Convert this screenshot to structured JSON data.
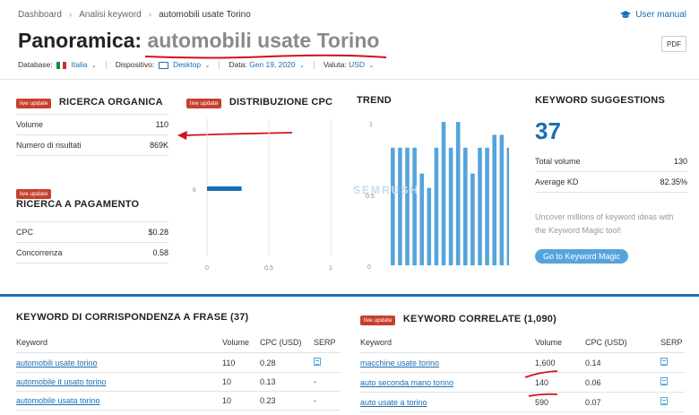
{
  "breadcrumb": {
    "items": [
      "Dashboard",
      "Analisi keyword",
      "automobili usate Torino"
    ]
  },
  "header": {
    "manual_label": "User manual",
    "title_prefix": "Panoramica:",
    "title_keyword": "automobili usate Torino",
    "pdf_label": "PDF"
  },
  "filters": {
    "database_label": "Database:",
    "database_value": "Italia",
    "device_label": "Dispositivo:",
    "device_value": "Desktop",
    "date_label": "Data:",
    "date_value": "Gen 19, 2020",
    "currency_label": "Valuta:",
    "currency_value": "USD"
  },
  "badge": "live update",
  "organic": {
    "title": "RICERCA ORGANICA",
    "rows": [
      {
        "label": "Volume",
        "value": "110"
      },
      {
        "label": "Numero di risultati",
        "value": "869K"
      }
    ]
  },
  "paid": {
    "title": "RICERCA A PAGAMENTO",
    "rows": [
      {
        "label": "CPC",
        "value": "$0.28"
      },
      {
        "label": "Concorrenza",
        "value": "0.58"
      }
    ]
  },
  "cpc_distribution": {
    "title": "DISTRIBUZIONE CPC",
    "bar_label": "it",
    "bar_value": 0.28,
    "ticks": [
      "0",
      "0.5",
      "1"
    ]
  },
  "trend": {
    "title": "TREND",
    "ytick_top": "1",
    "ytick_mid": "0.5",
    "ytick_bottom": "0",
    "watermark": "SEMRUSH",
    "values": [
      0.82,
      0.82,
      0.82,
      0.82,
      0.64,
      0.54,
      0.82,
      1.0,
      0.82,
      1.0,
      0.82,
      0.64,
      0.82,
      0.82,
      0.91,
      0.91,
      0.82
    ]
  },
  "suggestions": {
    "title": "KEYWORD SUGGESTIONS",
    "count": "37",
    "rows": [
      {
        "label": "Total volume",
        "value": "130"
      },
      {
        "label": "Average KD",
        "value": "82.35%"
      }
    ],
    "promo_line1": "Uncover millions of keyword ideas with",
    "promo_line2": "the Keyword Magic tool!",
    "button": "Go to Keyword Magic"
  },
  "phrase_match": {
    "title": "KEYWORD DI CORRISPONDENZA A FRASE (37)",
    "headers": [
      "Keyword",
      "Volume",
      "CPC (USD)",
      "SERP"
    ],
    "rows": [
      {
        "keyword": "automobili usate torino",
        "volume": "110",
        "cpc": "0.28",
        "serp": "icon"
      },
      {
        "keyword": "automobile it usato torino",
        "volume": "10",
        "cpc": "0.13",
        "serp": "-"
      },
      {
        "keyword": "automobile usata torino",
        "volume": "10",
        "cpc": "0.23",
        "serp": "-"
      }
    ]
  },
  "related": {
    "title": "KEYWORD CORRELATE (1,090)",
    "headers": [
      "Keyword",
      "Volume",
      "CPC (USD)",
      "SERP"
    ],
    "rows": [
      {
        "keyword": "macchine usate torino",
        "volume": "1,600",
        "cpc": "0.14",
        "serp": "icon"
      },
      {
        "keyword": "auto seconda mano torino",
        "volume": "140",
        "cpc": "0.06",
        "serp": "icon"
      },
      {
        "keyword": "auto usate a torino",
        "volume": "590",
        "cpc": "0.07",
        "serp": "icon"
      }
    ]
  },
  "colors": {
    "accent": "#1a6eb4",
    "bar": "#55a4db",
    "badge": "#c7402d",
    "annotation": "#d0121b"
  }
}
